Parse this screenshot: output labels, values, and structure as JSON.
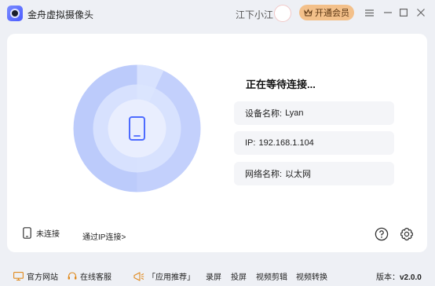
{
  "titlebar": {
    "app_title": "金舟虚拟摄像头",
    "user_name": "江下小江",
    "vip_label": "开通会员"
  },
  "main": {
    "status_title": "正在等待连接...",
    "device": {
      "label": "设备名称:",
      "value": "Lyan"
    },
    "ip": {
      "label": "IP:",
      "value": "192.168.1.104"
    },
    "network": {
      "label": "网络名称:",
      "value": "以太网"
    },
    "connection_status": "未连接",
    "ip_connect_link": "通过IP连接>"
  },
  "footer": {
    "official_site": "官方网站",
    "online_service": "在线客服",
    "app_recommend": "「应用推荐」",
    "links": [
      "录屏",
      "投屏",
      "视频剪辑",
      "视频转换"
    ],
    "version_label": "版本：",
    "version_value": "v2.0.0"
  },
  "colors": {
    "accent": "#4d6bff",
    "radar_outer": "#b9c8fb",
    "radar_inner": "#dde6ff",
    "vip": "#f3c08a"
  },
  "icons": {
    "app_logo": "camera-lens-icon",
    "vip": "crown-icon",
    "menu": "hamburger-icon",
    "minimize": "minimize-icon",
    "maximize": "maximize-icon",
    "close": "close-icon",
    "phone": "phone-icon",
    "help": "help-icon",
    "settings": "gear-icon",
    "website": "monitor-icon",
    "service": "headset-icon",
    "recommend": "megaphone-icon"
  }
}
